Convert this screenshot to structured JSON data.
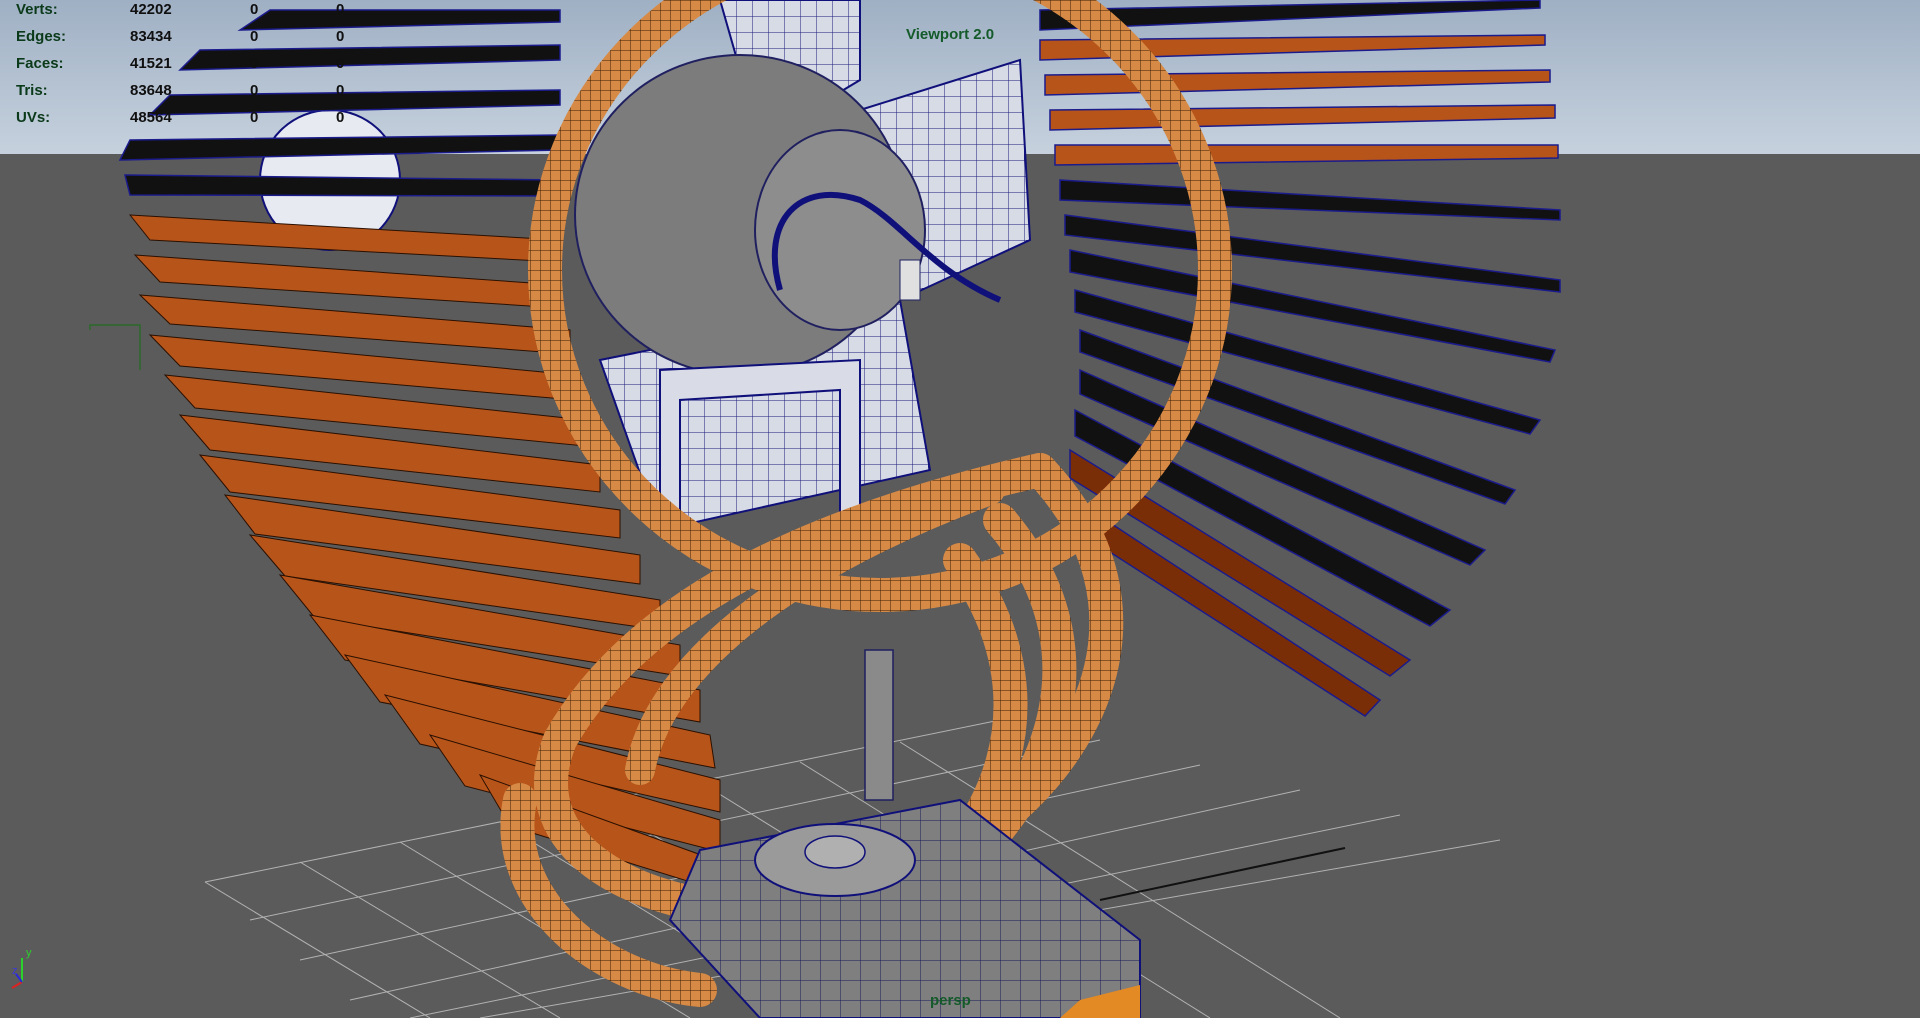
{
  "hud": {
    "stats": [
      {
        "label": "Verts:",
        "total": "42202",
        "selected": "0",
        "component": "0"
      },
      {
        "label": "Edges:",
        "total": "83434",
        "selected": "0",
        "component": "0"
      },
      {
        "label": "Faces:",
        "total": "41521",
        "selected": "0",
        "component": "0"
      },
      {
        "label": "Tris:",
        "total": "83648",
        "selected": "0",
        "component": "0"
      },
      {
        "label": "UVs:",
        "total": "48564",
        "selected": "0",
        "component": "0"
      }
    ]
  },
  "viewport": {
    "label": "Viewport 2.0",
    "camera": "persp"
  },
  "axis": {
    "y": "y",
    "z": "z"
  },
  "colors": {
    "sky": "#b8c6d6",
    "ground": "#5b5b5b",
    "copper": "#b7541a",
    "copper_pipe": "#d68a45",
    "wire": "#10107a",
    "mesh_grey": "#8a8a8a"
  }
}
